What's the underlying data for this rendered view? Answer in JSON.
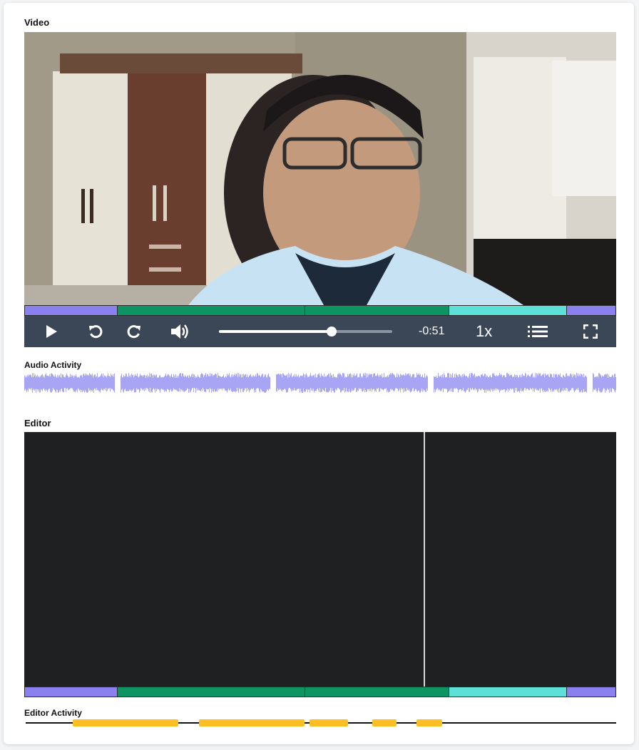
{
  "sections": {
    "video": "Video",
    "audio_activity": "Audio Activity",
    "editor": "Editor",
    "editor_activity": "Editor Activity"
  },
  "colors": {
    "segment_purple": "#8b80f0",
    "segment_green": "#0c9463",
    "segment_teal": "#5de0d8",
    "controls_bg": "#3b4656",
    "audio_wave": "#a9a5f5",
    "editor_bg": "#1e2022",
    "activity_block": "#fbbf24"
  },
  "timeline_segments": [
    {
      "color": "segment_purple",
      "fraction": 0.157
    },
    {
      "color": "segment_green",
      "fraction": 0.318
    },
    {
      "color": "segment_green",
      "fraction": 0.243
    },
    {
      "color": "segment_teal",
      "fraction": 0.199
    },
    {
      "color": "segment_purple",
      "fraction": 0.083
    }
  ],
  "player": {
    "play_icon": "play-icon",
    "rewind_icon": "rewind-icon",
    "forward_icon": "forward-icon",
    "volume_icon": "volume-icon",
    "progress_fraction": 0.65,
    "time_remaining": "-0:51",
    "playback_rate": "1x",
    "chapters_icon": "list-icon",
    "fullscreen_icon": "fullscreen-icon"
  },
  "audio_activity": {
    "gap_fractions": [
      0.157,
      0.42,
      0.686,
      0.955
    ]
  },
  "editor_panel": {
    "cursor_fraction": 0.675
  },
  "editor_activity": {
    "blocks": [
      {
        "start": 0.082,
        "end": 0.26
      },
      {
        "start": 0.295,
        "end": 0.474
      },
      {
        "start": 0.482,
        "end": 0.547
      },
      {
        "start": 0.588,
        "end": 0.629
      },
      {
        "start": 0.663,
        "end": 0.706
      }
    ]
  }
}
